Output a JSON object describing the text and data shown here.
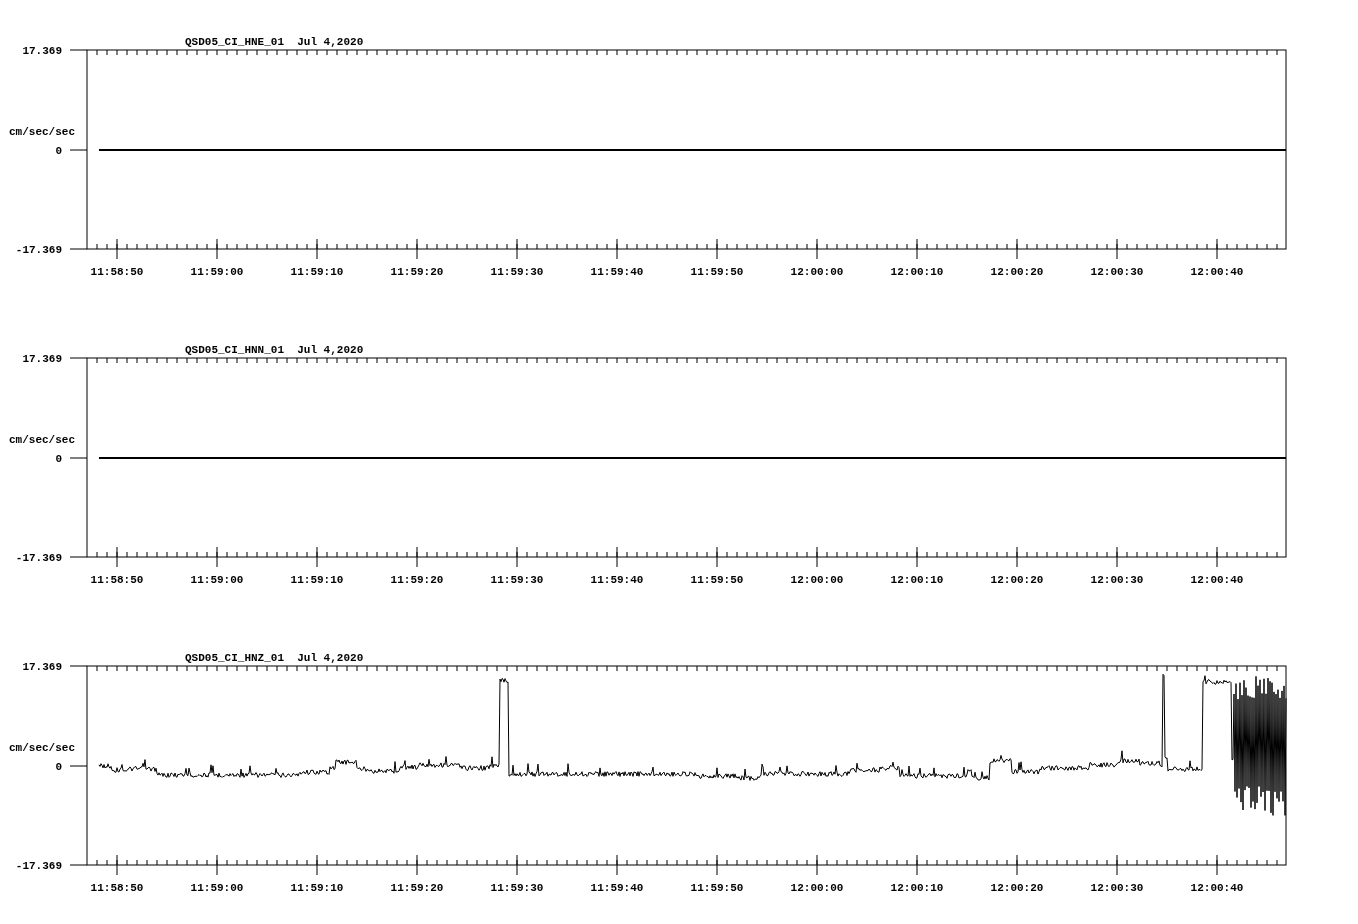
{
  "panels": [
    {
      "title": "QSD05_CI_HNE_01  Jul 4,2020",
      "ylabel": "cm/sec/sec",
      "yticks": [
        "17.369",
        "0",
        "-17.369"
      ],
      "xticks": [
        "11:58:50",
        "11:59:00",
        "11:59:10",
        "11:59:20",
        "11:59:30",
        "11:59:40",
        "11:59:50",
        "12:00:00",
        "12:00:10",
        "12:00:20",
        "12:00:30",
        "12:00:40"
      ],
      "trace": {
        "kind": "flat"
      }
    },
    {
      "title": "QSD05_CI_HNN_01  Jul 4,2020",
      "ylabel": "cm/sec/sec",
      "yticks": [
        "17.369",
        "0",
        "-17.369"
      ],
      "xticks": [
        "11:58:50",
        "11:59:00",
        "11:59:10",
        "11:59:20",
        "11:59:30",
        "11:59:40",
        "11:59:50",
        "12:00:00",
        "12:00:10",
        "12:00:20",
        "12:00:30",
        "12:00:40"
      ],
      "trace": {
        "kind": "flat"
      }
    },
    {
      "title": "QSD05_CI_HNZ_01  Jul 4,2020",
      "ylabel": "cm/sec/sec",
      "yticks": [
        "17.369",
        "0",
        "-17.369"
      ],
      "xticks": [
        "11:58:50",
        "11:59:00",
        "11:59:10",
        "11:59:20",
        "11:59:30",
        "11:59:40",
        "11:59:50",
        "12:00:00",
        "12:00:10",
        "12:00:20",
        "12:00:30",
        "12:00:40"
      ],
      "trace": {
        "kind": "waveform"
      }
    }
  ]
}
